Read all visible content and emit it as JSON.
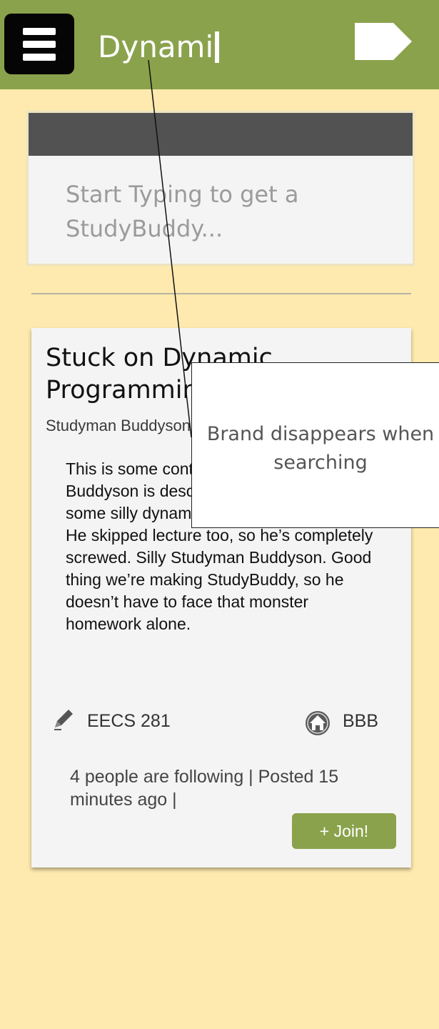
{
  "header": {
    "search_value": "Dynami",
    "menu_icon": "hamburger-menu-icon",
    "go_icon": "arrow-tag-icon",
    "bar_color": "#8aa24c"
  },
  "search_panel": {
    "placeholder": "Start Typing to get a StudyBuddy..."
  },
  "post": {
    "title": "Stuck on Dynamic Programming",
    "author": "Studyman Buddyson",
    "body": "This is some content about how Studyman Buddyson is describing how stuck he is on some silly dynamic programming problem. He skipped lecture too, so he’s completely screwed. Silly Studyman Buddyson. Good thing we’re making StudyBuddy, so he doesn’t have to face that monster homework alone.",
    "course_icon": "pencil-icon",
    "course": "EECS 281",
    "location_icon": "home-icon",
    "location": "BBB",
    "meta": "4 people are following | Posted 15 minutes ago |",
    "join_label": "+ Join!"
  },
  "annotation": {
    "text": "Brand disappears when searching"
  }
}
